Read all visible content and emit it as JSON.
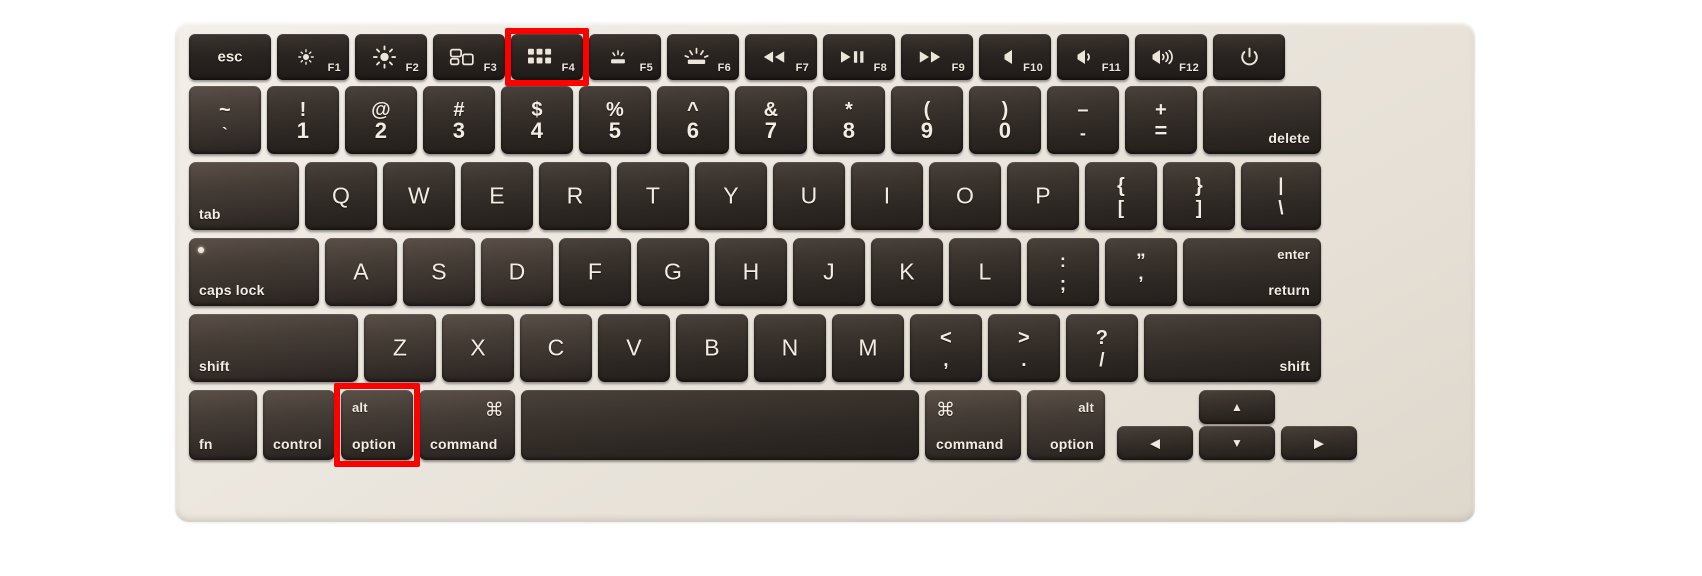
{
  "device": {
    "type": "macbook-keyboard",
    "layout": "US ANSI",
    "chassis_color": "#ece7df",
    "key_color": "#2c2622",
    "legend_color": "#f2ece2",
    "highlight_color": "#ff0000"
  },
  "highlights": [
    {
      "key": "F4",
      "label": "F4"
    },
    {
      "key": "option-left",
      "label": "alt / option"
    }
  ],
  "rows": {
    "function_row": [
      {
        "name": "esc",
        "label": "esc",
        "icon": "",
        "fn": ""
      },
      {
        "name": "f1",
        "label": "",
        "icon": "brightness-down-icon",
        "fn": "F1"
      },
      {
        "name": "f2",
        "label": "",
        "icon": "brightness-up-icon",
        "fn": "F2"
      },
      {
        "name": "f3",
        "label": "",
        "icon": "mission-control-icon",
        "fn": "F3"
      },
      {
        "name": "f4",
        "label": "",
        "icon": "launchpad-icon",
        "fn": "F4"
      },
      {
        "name": "f5",
        "label": "",
        "icon": "keyboard-backlight-down-icon",
        "fn": "F5"
      },
      {
        "name": "f6",
        "label": "",
        "icon": "keyboard-backlight-up-icon",
        "fn": "F6"
      },
      {
        "name": "f7",
        "label": "",
        "icon": "rewind-icon",
        "fn": "F7"
      },
      {
        "name": "f8",
        "label": "",
        "icon": "play-pause-icon",
        "fn": "F8"
      },
      {
        "name": "f9",
        "label": "",
        "icon": "fast-forward-icon",
        "fn": "F9"
      },
      {
        "name": "f10",
        "label": "",
        "icon": "mute-icon",
        "fn": "F10"
      },
      {
        "name": "f11",
        "label": "",
        "icon": "volume-down-icon",
        "fn": "F11"
      },
      {
        "name": "f12",
        "label": "",
        "icon": "volume-up-icon",
        "fn": "F12"
      },
      {
        "name": "power",
        "label": "",
        "icon": "power-icon",
        "fn": ""
      }
    ],
    "number_row": [
      {
        "name": "grave",
        "top": "~",
        "bottom": "`"
      },
      {
        "name": "one",
        "top": "!",
        "bottom": "1"
      },
      {
        "name": "two",
        "top": "@",
        "bottom": "2"
      },
      {
        "name": "three",
        "top": "#",
        "bottom": "3"
      },
      {
        "name": "four",
        "top": "$",
        "bottom": "4"
      },
      {
        "name": "five",
        "top": "%",
        "bottom": "5"
      },
      {
        "name": "six",
        "top": "^",
        "bottom": "6"
      },
      {
        "name": "seven",
        "top": "&",
        "bottom": "7"
      },
      {
        "name": "eight",
        "top": "*",
        "bottom": "8"
      },
      {
        "name": "nine",
        "top": "(",
        "bottom": "9"
      },
      {
        "name": "zero",
        "top": ")",
        "bottom": "0"
      },
      {
        "name": "minus",
        "top": "–",
        "bottom": "-"
      },
      {
        "name": "equal",
        "top": "+",
        "bottom": "="
      },
      {
        "name": "delete",
        "label": "delete"
      }
    ],
    "top_row": [
      {
        "name": "tab",
        "label": "tab"
      },
      {
        "name": "q",
        "label": "Q"
      },
      {
        "name": "w",
        "label": "W"
      },
      {
        "name": "e",
        "label": "E"
      },
      {
        "name": "r",
        "label": "R"
      },
      {
        "name": "t",
        "label": "T"
      },
      {
        "name": "y",
        "label": "Y"
      },
      {
        "name": "u",
        "label": "U"
      },
      {
        "name": "i",
        "label": "I"
      },
      {
        "name": "o",
        "label": "O"
      },
      {
        "name": "p",
        "label": "P"
      },
      {
        "name": "bracket-left",
        "top": "{",
        "bottom": "["
      },
      {
        "name": "bracket-right",
        "top": "}",
        "bottom": "]"
      },
      {
        "name": "backslash",
        "top": "|",
        "bottom": "\\"
      }
    ],
    "home_row": [
      {
        "name": "caps-lock",
        "label": "caps lock"
      },
      {
        "name": "a",
        "label": "A"
      },
      {
        "name": "s",
        "label": "S"
      },
      {
        "name": "d",
        "label": "D"
      },
      {
        "name": "f",
        "label": "F"
      },
      {
        "name": "g",
        "label": "G"
      },
      {
        "name": "h",
        "label": "H"
      },
      {
        "name": "j",
        "label": "J"
      },
      {
        "name": "k",
        "label": "K"
      },
      {
        "name": "l",
        "label": "L"
      },
      {
        "name": "semicolon",
        "top": ":",
        "bottom": ";"
      },
      {
        "name": "quote",
        "top": "”",
        "bottom": "’"
      },
      {
        "name": "return",
        "label_top": "enter",
        "label_bottom": "return"
      }
    ],
    "shift_row": [
      {
        "name": "shift-left",
        "label": "shift"
      },
      {
        "name": "z",
        "label": "Z"
      },
      {
        "name": "x",
        "label": "X"
      },
      {
        "name": "c",
        "label": "C"
      },
      {
        "name": "v",
        "label": "V"
      },
      {
        "name": "b",
        "label": "B"
      },
      {
        "name": "n",
        "label": "N"
      },
      {
        "name": "m",
        "label": "M"
      },
      {
        "name": "comma",
        "top": "<",
        "bottom": ","
      },
      {
        "name": "period",
        "top": ">",
        "bottom": "."
      },
      {
        "name": "slash",
        "top": "?",
        "bottom": "/"
      },
      {
        "name": "shift-right",
        "label": "shift"
      }
    ],
    "bottom_row": [
      {
        "name": "fn",
        "label": "fn"
      },
      {
        "name": "control",
        "label": "control"
      },
      {
        "name": "option-left",
        "label_top": "alt",
        "label_bottom": "option"
      },
      {
        "name": "command-left",
        "label_top": "⌘",
        "label_bottom": "command"
      },
      {
        "name": "space",
        "label": ""
      },
      {
        "name": "command-right",
        "label_top": "⌘",
        "label_bottom": "command"
      },
      {
        "name": "option-right",
        "label_top": "alt",
        "label_bottom": "option"
      },
      {
        "name": "arrow-left",
        "label": "◀"
      },
      {
        "name": "arrow-up",
        "label": "▲"
      },
      {
        "name": "arrow-down",
        "label": "▼"
      },
      {
        "name": "arrow-right",
        "label": "▶"
      }
    ]
  }
}
